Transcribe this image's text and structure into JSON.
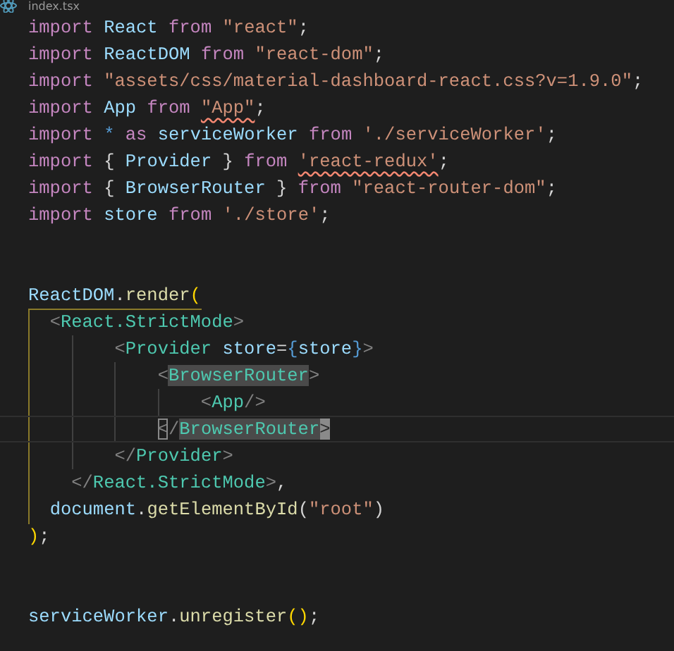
{
  "tab": {
    "title": "index.tsx"
  },
  "code_lines": [
    {
      "kind": "code",
      "tokens": [
        {
          "text": "import",
          "kind": "kw"
        },
        {
          "text": " React ",
          "kind": "var"
        },
        {
          "text": "from",
          "kind": "kw"
        },
        {
          "text": " \"react\"",
          "kind": "str"
        },
        {
          "text": ";",
          "kind": "punct"
        }
      ]
    },
    {
      "kind": "code",
      "tokens": [
        {
          "text": "import",
          "kind": "kw"
        },
        {
          "text": " ReactDOM ",
          "kind": "var"
        },
        {
          "text": "from",
          "kind": "kw"
        },
        {
          "text": " \"react-dom\"",
          "kind": "str"
        },
        {
          "text": ";",
          "kind": "punct"
        }
      ]
    },
    {
      "kind": "code",
      "tokens": [
        {
          "text": "import",
          "kind": "kw"
        },
        {
          "text": " \"assets/css/material-dashboard-react.css?v=1.9.0\"",
          "kind": "str"
        },
        {
          "text": ";",
          "kind": "punct"
        }
      ]
    },
    {
      "kind": "code",
      "tokens": [
        {
          "text": "import",
          "kind": "kw"
        },
        {
          "text": " App ",
          "kind": "var"
        },
        {
          "text": "from ",
          "kind": "kw"
        },
        {
          "text": "\"App\"",
          "kind": "errorstr"
        },
        {
          "text": ";",
          "kind": "punct"
        }
      ]
    },
    {
      "kind": "code",
      "tokens": [
        {
          "text": "import",
          "kind": "kw"
        },
        {
          "text": " * ",
          "kind": "op"
        },
        {
          "text": "as",
          "kind": "kw"
        },
        {
          "text": " serviceWorker ",
          "kind": "var"
        },
        {
          "text": "from",
          "kind": "kw"
        },
        {
          "text": " './serviceWorker'",
          "kind": "str"
        },
        {
          "text": ";",
          "kind": "punct"
        }
      ]
    },
    {
      "kind": "code",
      "tokens": [
        {
          "text": "import",
          "kind": "kw"
        },
        {
          "text": " { ",
          "kind": "punct"
        },
        {
          "text": "Provider",
          "kind": "var"
        },
        {
          "text": " } ",
          "kind": "punct"
        },
        {
          "text": "from ",
          "kind": "kw"
        },
        {
          "text": "'react-redux'",
          "kind": "errorstr"
        },
        {
          "text": ";",
          "kind": "punct"
        }
      ]
    },
    {
      "kind": "code",
      "tokens": [
        {
          "text": "import",
          "kind": "kw"
        },
        {
          "text": " { ",
          "kind": "punct"
        },
        {
          "text": "BrowserRouter",
          "kind": "var"
        },
        {
          "text": " } ",
          "kind": "punct"
        },
        {
          "text": "from",
          "kind": "kw"
        },
        {
          "text": " \"react-router-dom\"",
          "kind": "str"
        },
        {
          "text": ";",
          "kind": "punct"
        }
      ]
    },
    {
      "kind": "code",
      "tokens": [
        {
          "text": "import",
          "kind": "kw"
        },
        {
          "text": " store ",
          "kind": "var"
        },
        {
          "text": "from",
          "kind": "kw"
        },
        {
          "text": " './store'",
          "kind": "str"
        },
        {
          "text": ";",
          "kind": "punct"
        }
      ]
    },
    {
      "kind": "blank"
    },
    {
      "kind": "blank"
    },
    {
      "kind": "code",
      "tokens": [
        {
          "text": "ReactDOM",
          "kind": "var"
        },
        {
          "text": ".",
          "kind": "punct"
        },
        {
          "text": "render",
          "kind": "fn"
        },
        {
          "text": "(",
          "kind": "paren"
        }
      ]
    },
    {
      "kind": "code",
      "tokens": [
        {
          "text": "  <",
          "kind": "angle"
        },
        {
          "text": "React.StrictMode",
          "kind": "tag"
        },
        {
          "text": ">",
          "kind": "angle"
        }
      ]
    },
    {
      "kind": "code",
      "tokens": [
        {
          "text": "        <",
          "kind": "angle"
        },
        {
          "text": "Provider",
          "kind": "tag"
        },
        {
          "text": " store",
          "kind": "var"
        },
        {
          "text": "=",
          "kind": "punct"
        },
        {
          "text": "{",
          "kind": "op"
        },
        {
          "text": "store",
          "kind": "var"
        },
        {
          "text": "}",
          "kind": "op"
        },
        {
          "text": ">",
          "kind": "angle"
        }
      ]
    },
    {
      "kind": "code",
      "tokens": [
        {
          "text": "            <",
          "kind": "angle"
        },
        {
          "text": "BrowserRouter",
          "kind": "hltag"
        },
        {
          "text": ">",
          "kind": "angle"
        }
      ]
    },
    {
      "kind": "code",
      "tokens": [
        {
          "text": "                <",
          "kind": "angle"
        },
        {
          "text": "App",
          "kind": "tag"
        },
        {
          "text": "/>",
          "kind": "angle"
        }
      ]
    },
    {
      "kind": "current",
      "tokens": [
        {
          "text": "            <",
          "kind": "matchangle"
        },
        {
          "text": "/",
          "kind": "angle"
        },
        {
          "text": "BrowserRouter",
          "kind": "hltag"
        },
        {
          "text": ">",
          "kind": "selangle"
        }
      ]
    },
    {
      "kind": "code",
      "tokens": [
        {
          "text": "        </",
          "kind": "angle"
        },
        {
          "text": "Provider",
          "kind": "tag"
        },
        {
          "text": ">",
          "kind": "angle"
        }
      ]
    },
    {
      "kind": "code",
      "tokens": [
        {
          "text": "    </",
          "kind": "angle"
        },
        {
          "text": "React.StrictMode",
          "kind": "tag"
        },
        {
          "text": ">",
          "kind": "angle"
        },
        {
          "text": ",",
          "kind": "punct"
        }
      ]
    },
    {
      "kind": "code",
      "tokens": [
        {
          "text": "  document",
          "kind": "var"
        },
        {
          "text": ".",
          "kind": "punct"
        },
        {
          "text": "getElementById",
          "kind": "fn"
        },
        {
          "text": "(",
          "kind": "punct"
        },
        {
          "text": "\"root\"",
          "kind": "str"
        },
        {
          "text": ")",
          "kind": "punct"
        }
      ]
    },
    {
      "kind": "code",
      "tokens": [
        {
          "text": ")",
          "kind": "paren"
        },
        {
          "text": ";",
          "kind": "punct"
        }
      ]
    },
    {
      "kind": "blank"
    },
    {
      "kind": "blank"
    },
    {
      "kind": "code",
      "tokens": [
        {
          "text": "serviceWorker",
          "kind": "var"
        },
        {
          "text": ".",
          "kind": "punct"
        },
        {
          "text": "unregister",
          "kind": "fn"
        },
        {
          "text": "()",
          "kind": "paren"
        },
        {
          "text": ";",
          "kind": "punct"
        }
      ]
    }
  ]
}
